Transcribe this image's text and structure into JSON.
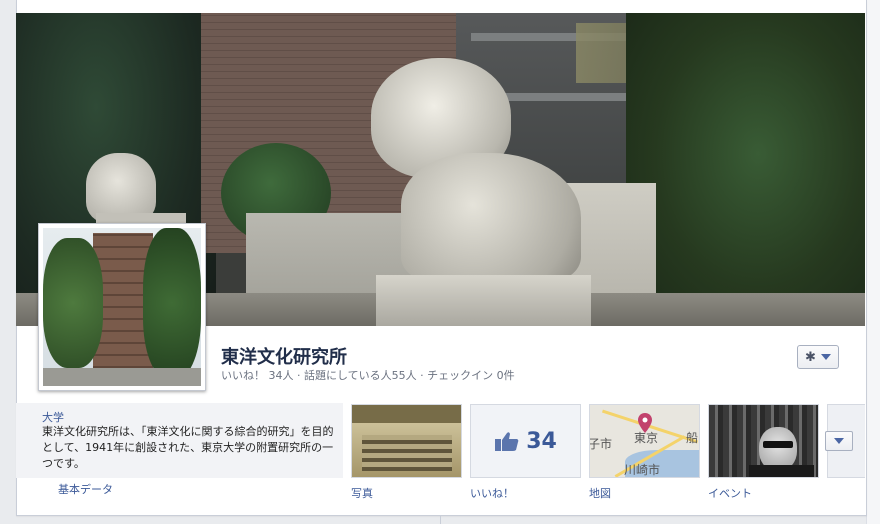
{
  "page": {
    "name": "東洋文化研究所",
    "stats": "いいね！ 34人 · 話題にしている人55人 · チェックイン 0件"
  },
  "about": {
    "category": "大学",
    "description": "東洋文化研究所は、「東洋文化に関する綜合的研究」を目的として、1941年に創設された、東京大学の附置研究所の一つです。",
    "link_label": "基本データ"
  },
  "tiles": {
    "photos_label": "写真",
    "likes_label": "いいね！",
    "likes_count": "34",
    "map_label": "地図",
    "events_label": "イベント",
    "map_places": {
      "tokyo": "東京",
      "kawasaki": "川崎市",
      "ko": "子市",
      "funa": "船"
    }
  },
  "icons": {
    "settings": "gear-icon",
    "dropdown": "chevron-down-icon",
    "like": "thumbs-up-icon",
    "map_pin": "map-pin-icon"
  },
  "colors": {
    "brand": "#3b5998",
    "title": "#212e4a"
  }
}
